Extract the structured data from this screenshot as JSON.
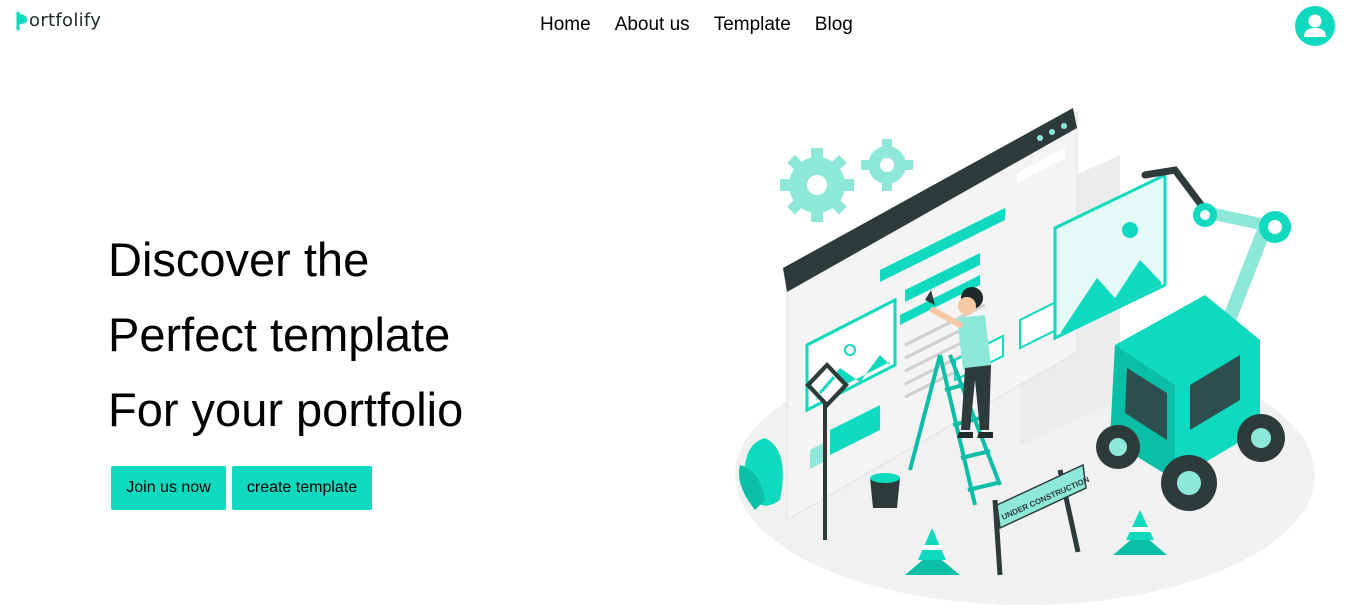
{
  "brand": {
    "logo_text": "ortfolify",
    "accent_color": "#0fd9be"
  },
  "nav": {
    "links": [
      {
        "label": "Home"
      },
      {
        "label": "About us"
      },
      {
        "label": "Template"
      },
      {
        "label": "Blog"
      }
    ],
    "avatar_icon": "user-icon"
  },
  "hero": {
    "lines": [
      "Discover the",
      "Perfect template",
      "For your portfolio"
    ],
    "primary_button": "Join us now",
    "secondary_button": "create template"
  },
  "illustration": {
    "banner_text": "UNDER CONSTRUCTION",
    "icons": [
      "gear-icon",
      "image-icon",
      "traffic-cone-icon",
      "crane-truck-icon",
      "ladder-icon",
      "paint-bucket-icon",
      "tools-sign-icon",
      "plant-icon"
    ]
  }
}
